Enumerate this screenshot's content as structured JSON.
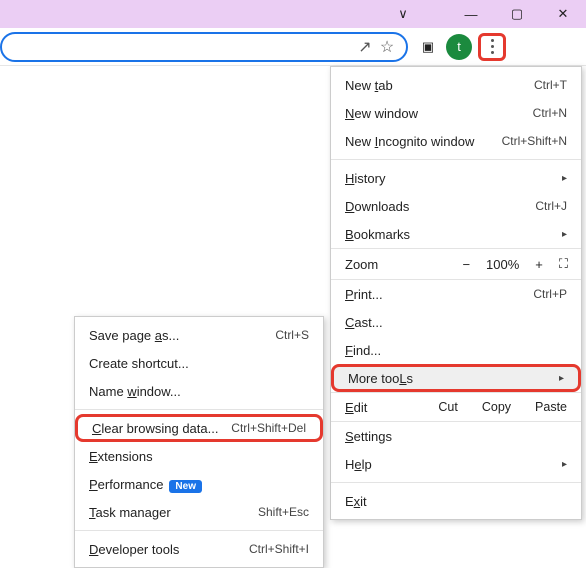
{
  "titlebar": {
    "dropdown": "∨",
    "min": "—",
    "max": "▢",
    "close": "✕"
  },
  "omnibox": {
    "share": "↗",
    "star": "☆"
  },
  "toolbar": {
    "side": "▣",
    "avatar": "t"
  },
  "menu": {
    "new_tab": {
      "label": "New tab",
      "u": "t",
      "shortcut": "Ctrl+T"
    },
    "new_window": {
      "label": "New window",
      "u": "N",
      "shortcut": "Ctrl+N"
    },
    "new_incog": {
      "label": "New Incognito window",
      "u": "I",
      "shortcut": "Ctrl+Shift+N"
    },
    "history": {
      "label": "History",
      "u": "H"
    },
    "downloads": {
      "label": "Downloads",
      "u": "D",
      "shortcut": "Ctrl+J"
    },
    "bookmarks": {
      "label": "Bookmarks",
      "u": "B"
    },
    "zoom": {
      "label": "Zoom",
      "minus": "−",
      "value": "100%",
      "plus": "+",
      "full": "⛶"
    },
    "print": {
      "label": "Print...",
      "u": "P",
      "shortcut": "Ctrl+P"
    },
    "cast": {
      "label": "Cast...",
      "u": "C"
    },
    "find": {
      "label": "Find...",
      "u": "F"
    },
    "more_tools": {
      "label": "More tools",
      "u": "L"
    },
    "edit": {
      "label": "Edit",
      "u": "E",
      "cut": "Cut",
      "copy": "Copy",
      "paste": "Paste"
    },
    "settings": {
      "label": "Settings",
      "u": "S"
    },
    "help": {
      "label": "Help",
      "u": "e"
    },
    "exit": {
      "label": "Exit",
      "u": "x"
    }
  },
  "sub": {
    "save_page": {
      "label": "Save page as...",
      "u": "a",
      "shortcut": "Ctrl+S"
    },
    "create_shortcut": {
      "label": "Create shortcut..."
    },
    "name_window": {
      "label": "Name window...",
      "u": "w"
    },
    "clear_data": {
      "label": "Clear browsing data...",
      "u": "C",
      "shortcut": "Ctrl+Shift+Del"
    },
    "extensions": {
      "label": "Extensions",
      "u": "E"
    },
    "performance": {
      "label": "Performance",
      "u": "P",
      "badge": "New"
    },
    "task_manager": {
      "label": "Task manager",
      "u": "T",
      "shortcut": "Shift+Esc"
    },
    "dev_tools": {
      "label": "Developer tools",
      "u": "D",
      "shortcut": "Ctrl+Shift+I"
    }
  }
}
